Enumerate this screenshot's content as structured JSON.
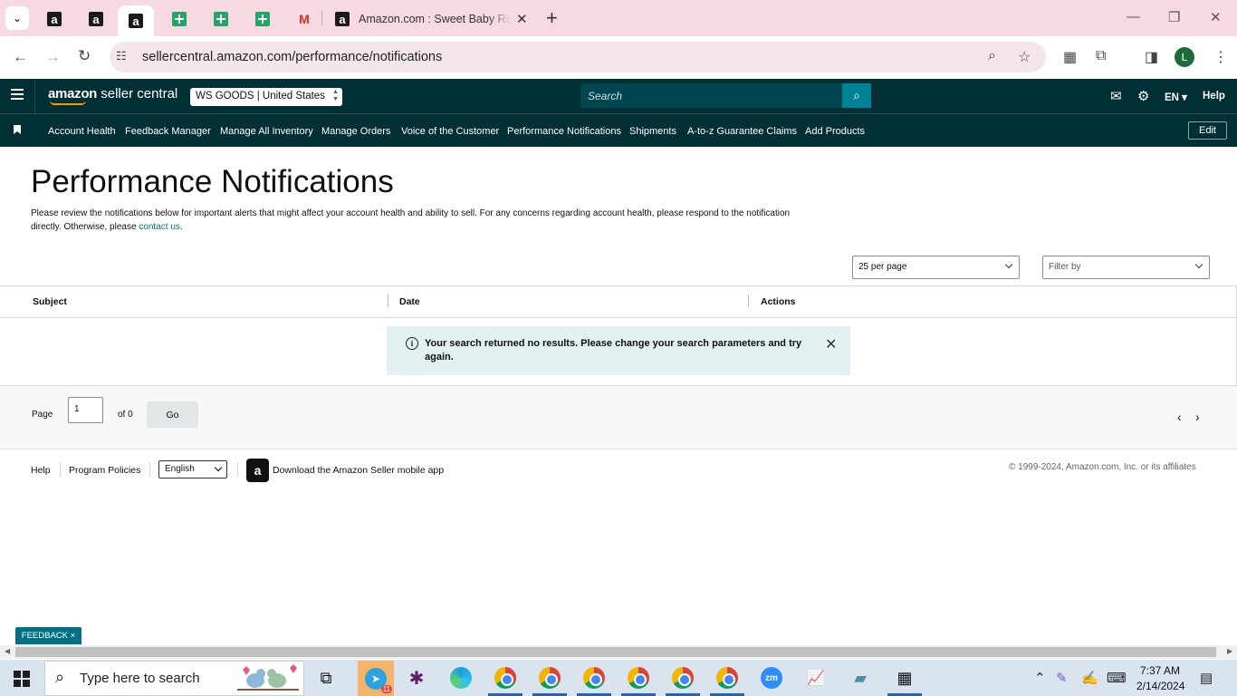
{
  "browser": {
    "active_tab_title": "Amazon.com : Sweet Baby Ray's",
    "url": "sellercentral.amazon.com/performance/notifications",
    "profile_initial": "L"
  },
  "header": {
    "logo_amazon": "amazon",
    "logo_suffix": "seller central",
    "store": "WS GOODS | United States",
    "search_placeholder": "Search",
    "language": "EN ▾",
    "help": "Help"
  },
  "nav": {
    "items": [
      "Account Health",
      "Feedback Manager",
      "Manage All Inventory",
      "Manage Orders",
      "Voice of the Customer",
      "Performance Notifications",
      "Shipments",
      "A-to-z Guarantee Claims",
      "Add Products"
    ],
    "edit": "Edit"
  },
  "page": {
    "title": "Performance Notifications",
    "description": "Please review the notifications below for important alerts that might affect your account health and ability to sell. For any concerns regarding account health, please respond to the notification directly. Otherwise, please",
    "contact_link": "contact us",
    "per_page": "25 per page",
    "filter_placeholder": "Filter by"
  },
  "table": {
    "columns": [
      "Subject",
      "Date",
      "Actions"
    ],
    "empty_message": "Your search returned no results. Please change your search parameters and try again."
  },
  "pagination": {
    "page_label": "Page",
    "page_value": "1",
    "of_label": "of 0",
    "go": "Go"
  },
  "footer": {
    "help": "Help",
    "program_policies": "Program Policies",
    "language": "English",
    "app_link": "Download the Amazon Seller mobile app",
    "copyright": "© 1999-2024, Amazon.com, Inc. or its affiliates"
  },
  "feedback": "FEEDBACK ×",
  "taskbar": {
    "search_placeholder": "Type here to search",
    "time": "7:37 AM",
    "date": "2/14/2024",
    "telegram_badge": "11",
    "zoom_label": "zm"
  },
  "colors": {
    "header_bg": "#002f36",
    "accent": "#008296",
    "link": "#007185",
    "alert_bg": "#e4f1f2"
  }
}
